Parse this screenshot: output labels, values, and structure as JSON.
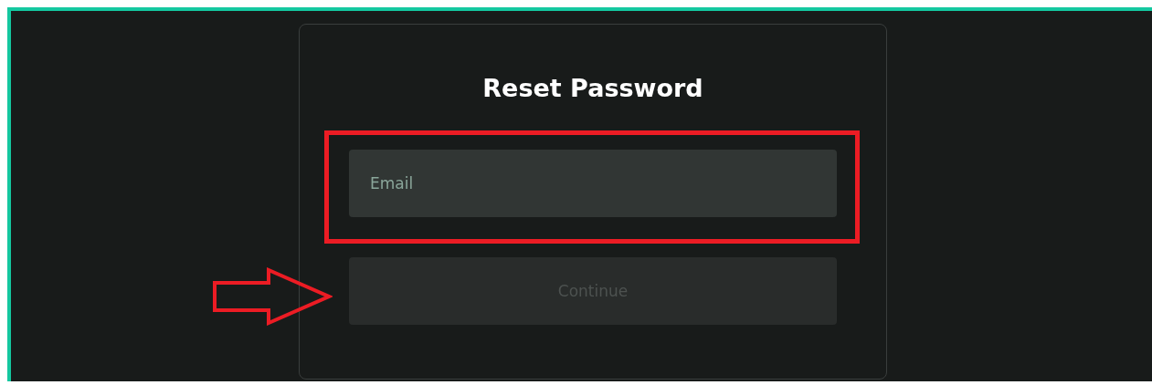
{
  "card": {
    "title": "Reset Password"
  },
  "email_field": {
    "placeholder": "Email"
  },
  "continue_button": {
    "label": "Continue",
    "disabled": true
  }
}
